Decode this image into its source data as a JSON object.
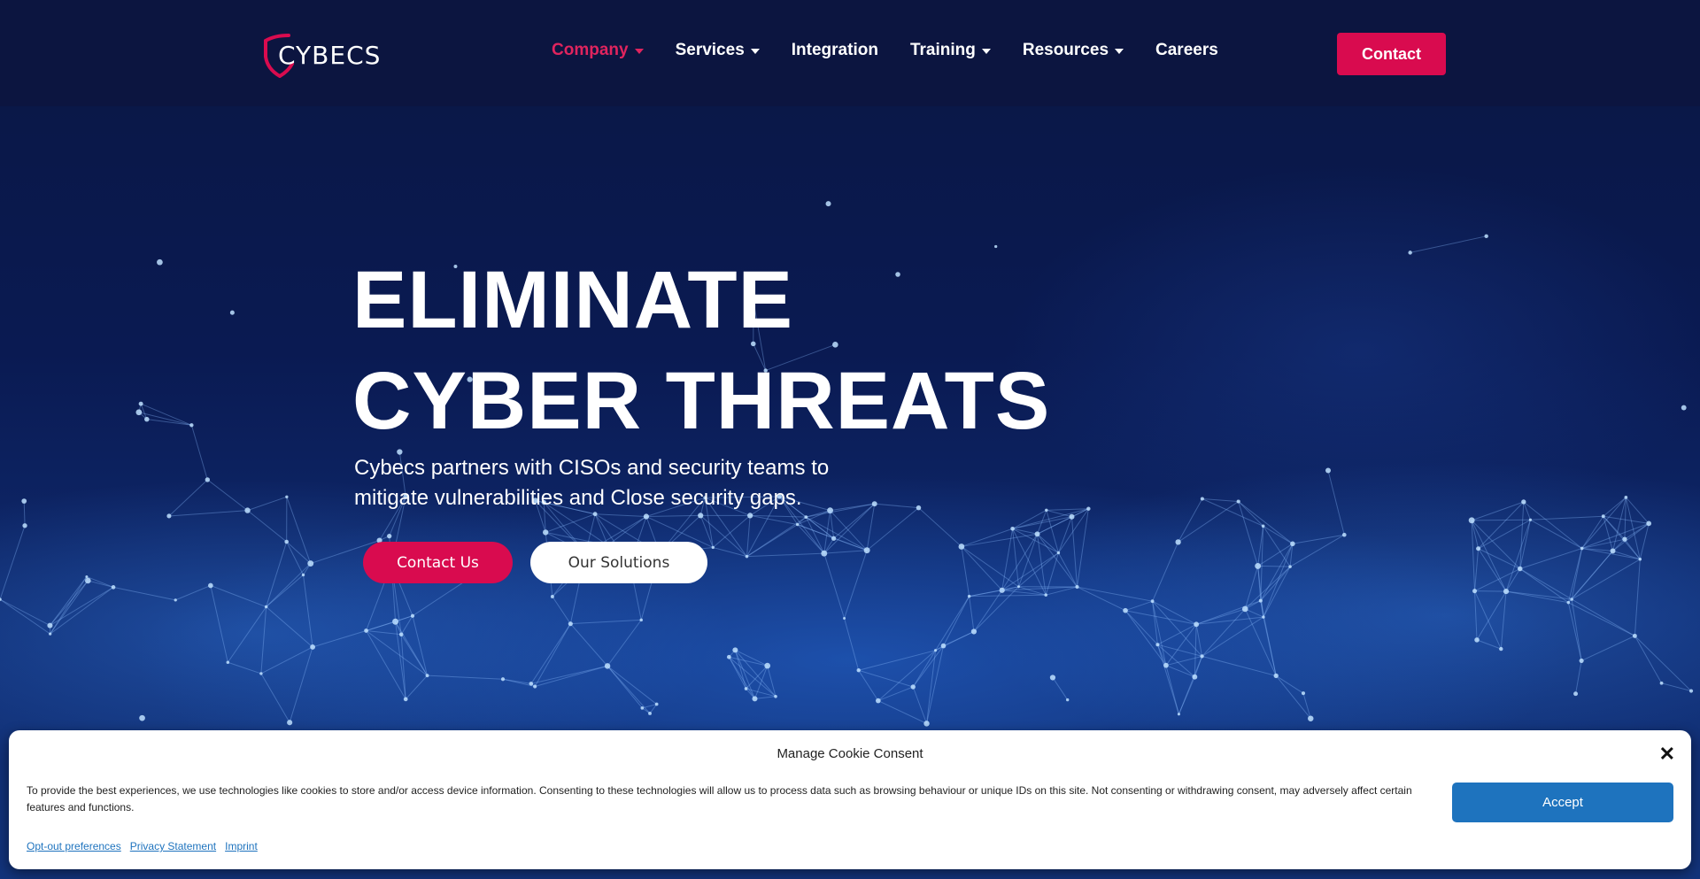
{
  "header": {
    "logo_text": "CYBECS",
    "nav": [
      {
        "label": "Company",
        "dropdown": true,
        "active": true
      },
      {
        "label": "Services",
        "dropdown": true,
        "active": false
      },
      {
        "label": "Integration",
        "dropdown": false,
        "active": false
      },
      {
        "label": "Training",
        "dropdown": true,
        "active": false
      },
      {
        "label": "Resources",
        "dropdown": true,
        "active": false
      },
      {
        "label": "Careers",
        "dropdown": false,
        "active": false
      }
    ],
    "contact_label": "Contact"
  },
  "hero": {
    "headline_line1": "ELIMINATE",
    "headline_line2": "CYBER THREATS",
    "subtitle": "Cybecs partners with CISOs and security teams to mitigate vulnerabilities and Close security gaps.",
    "primary_button": "Contact Us",
    "secondary_button": "Our Solutions"
  },
  "cookie": {
    "title": "Manage Cookie Consent",
    "close_icon": "close-icon",
    "text": "To provide the best experiences, we use technologies like cookies to store and/or access device information. Consenting to these technologies will allow us to process data such as browsing behaviour or unique IDs on this site. Not consenting or withdrawing consent, may adversely affect certain features and functions.",
    "accept_label": "Accept",
    "links": [
      "Opt-out preferences",
      "Privacy Statement",
      "Imprint"
    ]
  },
  "colors": {
    "brand_red": "#d90b4f",
    "nav_active": "#e0245e",
    "navy": "#0c1540",
    "accept_blue": "#1e73be"
  }
}
